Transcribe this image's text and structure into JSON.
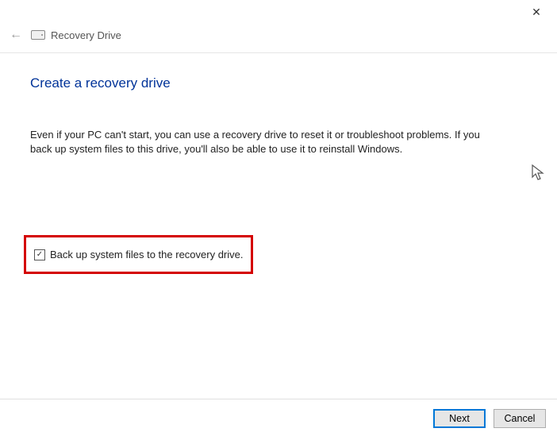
{
  "titlebar": {
    "close_glyph": "✕"
  },
  "header": {
    "back_arrow_glyph": "←",
    "window_title": "Recovery Drive"
  },
  "main": {
    "heading": "Create a recovery drive",
    "description": "Even if your PC can't start, you can use a recovery drive to reset it or troubleshoot problems. If you back up system files to this drive, you'll also be able to use it to reinstall Windows."
  },
  "checkbox": {
    "checked_glyph": "✓",
    "label": "Back up system files to the recovery drive."
  },
  "buttons": {
    "next": "Next",
    "cancel": "Cancel"
  }
}
